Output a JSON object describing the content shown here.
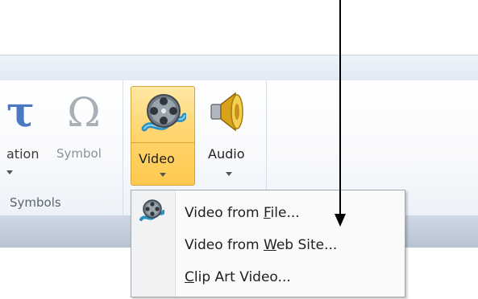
{
  "ribbon": {
    "symbols_group": {
      "equation_glyph": "τ",
      "equation_label": "ation",
      "symbol_glyph": "Ω",
      "symbol_label": "Symbol",
      "group_label": "Symbols"
    },
    "media_group": {
      "video_label": "Video",
      "audio_label": "Audio"
    }
  },
  "video_menu": {
    "items": [
      {
        "before": "Video from ",
        "mnemonic": "F",
        "after": "ile...",
        "icon": "film-reel-icon"
      },
      {
        "before": "Video from ",
        "mnemonic": "W",
        "after": "eb Site...",
        "icon": null
      },
      {
        "before": "",
        "mnemonic": "C",
        "after": "lip Art Video...",
        "icon": null
      }
    ]
  },
  "colors": {
    "pressed_button_fill": "#ffd670",
    "pressed_button_border": "#d9a43a",
    "equation_blue": "#4a78c2",
    "annotation_arrow": "#000000"
  },
  "icons": [
    "equation-icon",
    "omega-symbol-icon",
    "film-reel-icon",
    "speaker-icon",
    "dropdown-arrow-icon",
    "annotation-arrow"
  ]
}
